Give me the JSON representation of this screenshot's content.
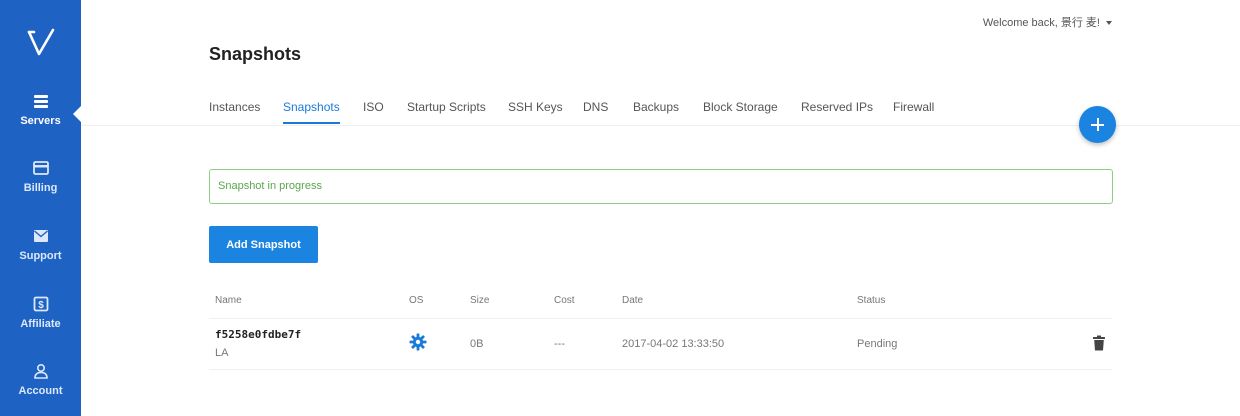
{
  "sidebar": {
    "items": [
      {
        "label": "Servers",
        "icon": "servers-icon",
        "active": true
      },
      {
        "label": "Billing",
        "icon": "credit-card-icon"
      },
      {
        "label": "Support",
        "icon": "envelope-icon"
      },
      {
        "label": "Affiliate",
        "icon": "dollar-icon"
      },
      {
        "label": "Account",
        "icon": "user-icon"
      }
    ]
  },
  "header": {
    "welcome": "Welcome back, 景行 麦!"
  },
  "page": {
    "title": "Snapshots"
  },
  "tabs": [
    {
      "label": "Instances"
    },
    {
      "label": "Snapshots",
      "active": true
    },
    {
      "label": "ISO"
    },
    {
      "label": "Startup Scripts"
    },
    {
      "label": "SSH Keys"
    },
    {
      "label": "DNS"
    },
    {
      "label": "Backups"
    },
    {
      "label": "Block Storage"
    },
    {
      "label": "Reserved IPs"
    },
    {
      "label": "Firewall"
    }
  ],
  "alert": {
    "text": "Snapshot in progress"
  },
  "actions": {
    "add_snapshot": "Add Snapshot"
  },
  "table": {
    "columns": {
      "name": "Name",
      "os": "OS",
      "size": "Size",
      "cost": "Cost",
      "date": "Date",
      "status": "Status"
    },
    "rows": [
      {
        "name": "f5258e0fdbe7f",
        "location": "LA",
        "os_icon": "os-gear-icon",
        "size": "0B",
        "cost": "---",
        "date": "2017-04-02 13:33:50",
        "status": "Pending"
      }
    ]
  },
  "colors": {
    "sidebar": "#1e62c4",
    "accent": "#1a84e0",
    "success": "#5aa64f"
  }
}
